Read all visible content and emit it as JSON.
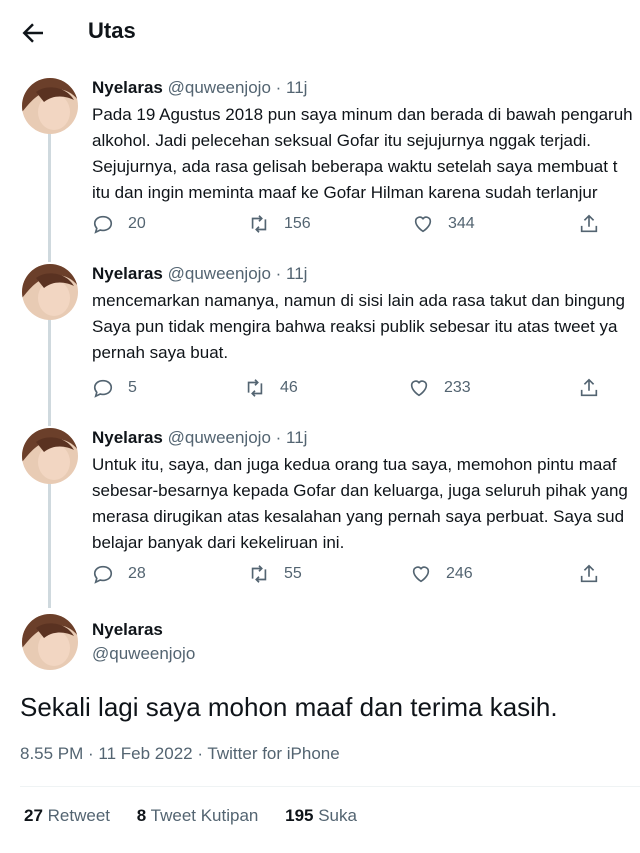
{
  "header": {
    "title": "Utas",
    "back_icon": "arrow-left-icon"
  },
  "thread": [
    {
      "name": "Nyelaras",
      "handle": "@quweenjojo",
      "sep": " · ",
      "time": "11j",
      "lines": [
        "Pada 19 Agustus 2018 pun saya minum dan berada di bawah pengaruh",
        "alkohol. Jadi pelecehan seksual Gofar itu sejujurnya nggak terjadi.",
        "Sejujurnya, ada rasa gelisah beberapa waktu setelah saya membuat t",
        "itu dan ingin meminta maaf ke Gofar Hilman karena sudah terlanjur"
      ],
      "replies": "20",
      "retweets": "156",
      "likes": "344"
    },
    {
      "name": "Nyelaras",
      "handle": "@quweenjojo",
      "sep": " · ",
      "time": "11j",
      "lines": [
        "mencemarkan namanya, namun di sisi lain ada rasa takut dan bingung",
        "Saya pun tidak mengira bahwa reaksi publik sebesar itu atas tweet ya",
        "pernah saya buat."
      ],
      "replies": "5",
      "retweets": "46",
      "likes": "233"
    },
    {
      "name": "Nyelaras",
      "handle": "@quweenjojo",
      "sep": " · ",
      "time": "11j",
      "lines": [
        "Untuk itu, saya, dan juga kedua orang tua saya, memohon pintu maaf",
        "sebesar-besarnya kepada Gofar dan keluarga, juga seluruh pihak yang",
        "merasa dirugikan atas kesalahan yang pernah saya perbuat. Saya sud",
        "belajar banyak dari kekeliruan ini."
      ],
      "replies": "28",
      "retweets": "55",
      "likes": "246"
    }
  ],
  "main_tweet": {
    "name": "Nyelaras",
    "handle": "@quweenjojo",
    "text": "Sekali lagi saya mohon maaf dan terima kasih.",
    "meta": "8.55 PM · 11 Feb 2022 · Twitter for iPhone",
    "retweet_count": "27",
    "retweet_label": " Retweet",
    "quote_count": "8",
    "quote_label": " Tweet Kutipan",
    "like_count": "195",
    "like_label": " Suka"
  },
  "colors": {
    "text": "#0f1419",
    "secondary": "#536471",
    "line": "#cfd9de"
  }
}
